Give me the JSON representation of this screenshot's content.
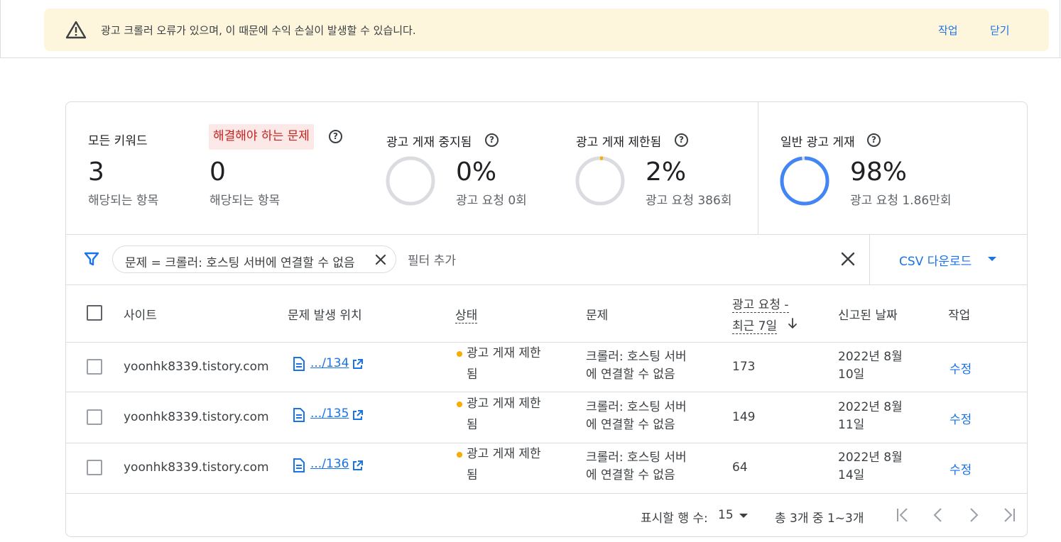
{
  "banner": {
    "message": "광고 크롤러 오류가 있으며, 이 때문에 수익 손실이 발생할 수 있습니다.",
    "action_label": "작업",
    "close_label": "닫기"
  },
  "summary": {
    "all_keywords": {
      "title": "모든 키워드",
      "value": "3",
      "sub": "해당되는 항목"
    },
    "issues": {
      "title": "해결해야 하는 문제",
      "value": "0",
      "sub": "해당되는 항목"
    },
    "stopped": {
      "title": "광고 게재 중지됨",
      "value": "0%",
      "sub": "광고 요청 0회",
      "fraction": 0.0
    },
    "limited": {
      "title": "광고 게재 제한됨",
      "value": "2%",
      "sub": "광고 요청 386회",
      "fraction": 0.02
    },
    "normal": {
      "title": "일반 광고 게재",
      "value": "98%",
      "sub": "광고 요청 1.86만회",
      "fraction": 0.98
    },
    "help_glyph": "?"
  },
  "filter": {
    "chip_text": "문제 = 크롤러: 호스팅 서버에 연결할 수 없음",
    "add_filter_label": "필터 추가",
    "csv_label": "CSV 다운로드"
  },
  "table": {
    "headers": {
      "site": "사이트",
      "location": "문제 발생 위치",
      "status": "상태",
      "issue": "문제",
      "requests_line1": "광고 요청 -",
      "requests_line2": "최근 7일",
      "reported": "신고된 날짜",
      "action": "작업"
    },
    "rows": [
      {
        "site": "yoonhk8339.tistory.com",
        "location": ".../134",
        "status_line1": "광고 게재 제한",
        "status_line2": "됨",
        "issue_line1": "크롤러: 호스팅 서버",
        "issue_line2": "에 연결할 수 없음",
        "requests": "173",
        "date_line1": "2022년 8월",
        "date_line2": "10일",
        "action": "수정"
      },
      {
        "site": "yoonhk8339.tistory.com",
        "location": ".../135",
        "status_line1": "광고 게재 제한",
        "status_line2": "됨",
        "issue_line1": "크롤러: 호스팅 서버",
        "issue_line2": "에 연결할 수 없음",
        "requests": "149",
        "date_line1": "2022년 8월",
        "date_line2": "11일",
        "action": "수정"
      },
      {
        "site": "yoonhk8339.tistory.com",
        "location": ".../136",
        "status_line1": "광고 게재 제한",
        "status_line2": "됨",
        "issue_line1": "크롤러: 호스팅 서버",
        "issue_line2": "에 연결할 수 없음",
        "requests": "64",
        "date_line1": "2022년 8월",
        "date_line2": "14일",
        "action": "수정"
      }
    ]
  },
  "pager": {
    "rows_label": "표시할 행 수:",
    "rows_value": "15",
    "range_text": "총 3개 중 1~3개"
  },
  "colors": {
    "accent": "#1a73e8",
    "warning_bg": "#fdf6dc",
    "issue_chip_bg": "#fce8e6",
    "issue_chip_text": "#c5221f",
    "limited_dot": "#f9ab00",
    "donut_track": "#dadce0"
  }
}
